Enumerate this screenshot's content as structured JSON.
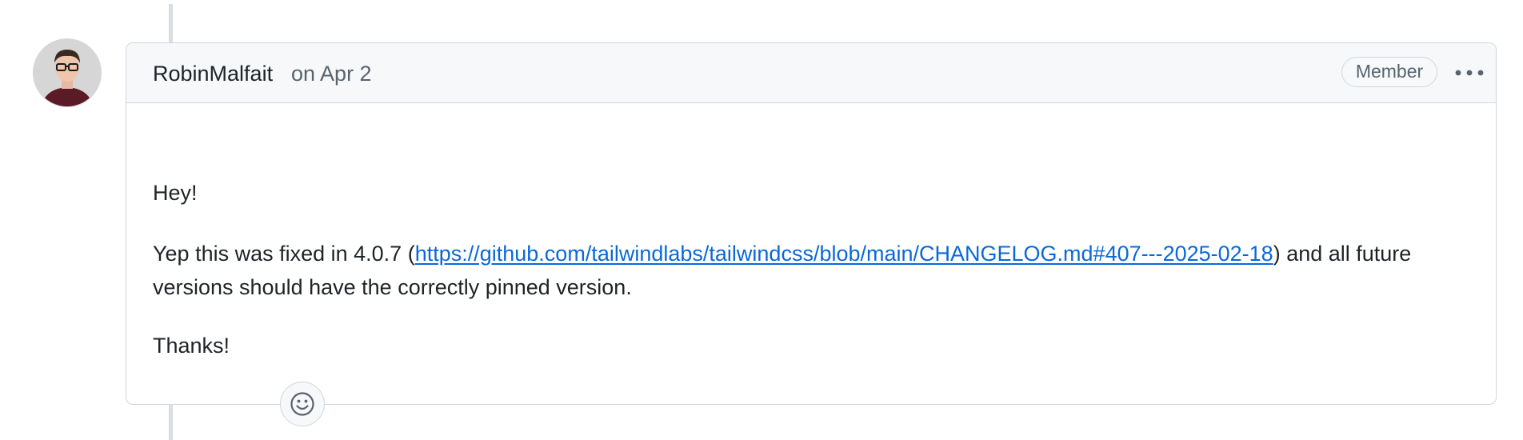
{
  "comment": {
    "author": "RobinMalfait",
    "timestamp": "on Apr 2",
    "role_badge": "Member",
    "more_actions_icon": "kebab-horizontal-icon",
    "body": {
      "greeting": "Hey!",
      "fix_text_before": "Yep this was fixed in 4.0.7 (",
      "link_text": "https://github.com/tailwindlabs/tailwindcss/blob/main/CHANGELOG.md#407---2025-02-18",
      "fix_text_after": ") and all future versions should have the correctly pinned version.",
      "closing": "Thanks!"
    },
    "reaction_icon": "smiley-icon"
  },
  "colors": {
    "link": "#0969da",
    "border": "#d0d7de",
    "header_bg": "#f6f8fa",
    "muted_text": "#59636e",
    "timeline": "#d8dee4"
  }
}
